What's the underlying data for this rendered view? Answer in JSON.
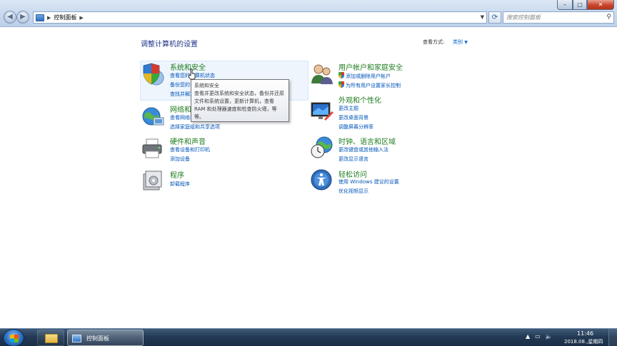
{
  "address": {
    "breadcrumb": "控制面板"
  },
  "search": {
    "placeholder": "搜索控制面板"
  },
  "page_title": "调整计算机的设置",
  "view_by": {
    "label": "查看方式:",
    "value": "类别"
  },
  "categories": [
    {
      "title": "系统和安全",
      "links": [
        "查看您的计算机状态",
        "备份您的计算机",
        "查找并解决问题"
      ]
    },
    {
      "title": "网络和 Internet",
      "links": [
        "查看网络状态和任务",
        "选择家庭组和共享选项"
      ]
    },
    {
      "title": "硬件和声音",
      "links": [
        "查看设备和打印机",
        "添加设备"
      ]
    },
    {
      "title": "程序",
      "links": [
        "卸载程序"
      ]
    },
    {
      "title": "用户帐户和家庭安全",
      "links": [
        "添加或删除用户帐户",
        "为所有用户设置家长控制"
      ]
    },
    {
      "title": "外观和个性化",
      "links": [
        "更改主题",
        "更改桌面背景",
        "调整屏幕分辨率"
      ]
    },
    {
      "title": "时钟、语言和区域",
      "links": [
        "更改键盘或其他输入法",
        "更改显示语言"
      ]
    },
    {
      "title": "轻松访问",
      "links": [
        "使用 Windows 建议的设置",
        "优化视频显示"
      ]
    }
  ],
  "tooltip": {
    "title": "系统和安全",
    "body": "查看并更改系统和安全状态，备份并还原文件和系统设置，更新计算机，查看 RAM 和处理器速度和检查防火墙，等等。"
  },
  "taskbar": {
    "active_window": "控制面板"
  },
  "clock": {
    "time": "11:46",
    "date": "2018.08.,星期四"
  }
}
